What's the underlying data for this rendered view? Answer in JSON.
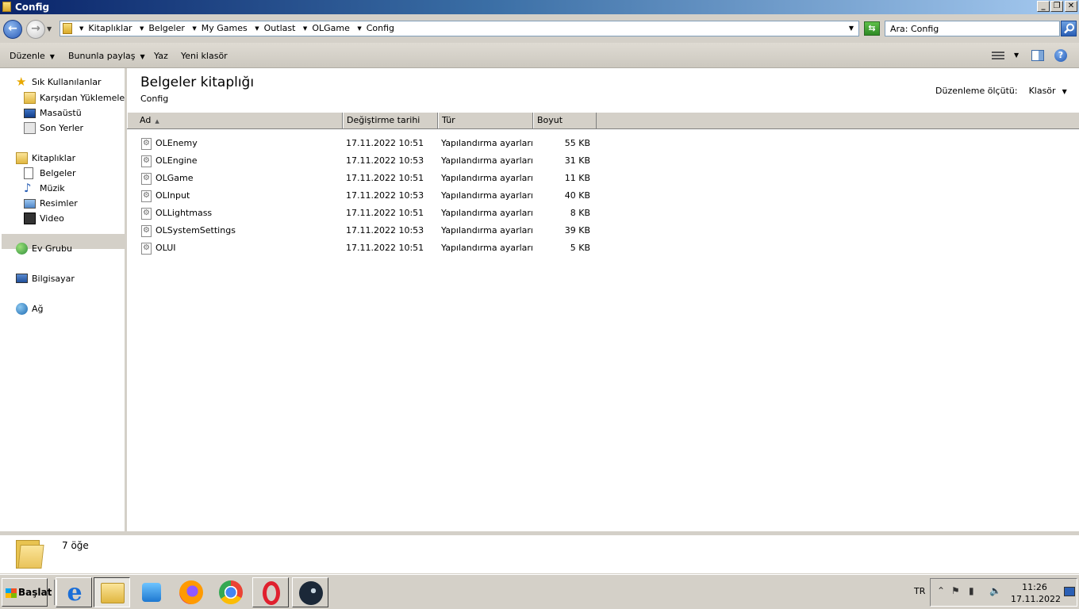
{
  "window": {
    "title": "Config",
    "controls": [
      "_",
      "❐",
      "✕"
    ]
  },
  "address": {
    "crumbs": [
      "Kitaplıklar",
      "Belgeler",
      "My Games",
      "Outlast",
      "OLGame",
      "Config"
    ]
  },
  "search": {
    "value": "Ara: Config"
  },
  "toolbar": {
    "organize": "Düzenle",
    "share": "Bununla paylaş",
    "burn": "Yaz",
    "new_folder": "Yeni klasör"
  },
  "nav": {
    "favorites": "Sık Kullanılanlar",
    "downloads": "Karşıdan Yüklemeler",
    "desktop": "Masaüstü",
    "recent": "Son Yerler",
    "libraries": "Kitaplıklar",
    "documents": "Belgeler",
    "music": "Müzik",
    "pictures": "Resimler",
    "video": "Video",
    "homegroup": "Ev Grubu",
    "computer": "Bilgisayar",
    "network": "Ağ"
  },
  "library": {
    "title": "Belgeler kitaplığı",
    "subtitle": "Config",
    "arrange_label": "Düzenleme ölçütü:",
    "arrange_value": "Klasör"
  },
  "columns": {
    "name": "Ad",
    "date": "Değiştirme tarihi",
    "type": "Tür",
    "size": "Boyut"
  },
  "files": [
    {
      "name": "OLEnemy",
      "date": "17.11.2022 10:51",
      "type": "Yapılandırma ayarları",
      "size": "55 KB"
    },
    {
      "name": "OLEngine",
      "date": "17.11.2022 10:53",
      "type": "Yapılandırma ayarları",
      "size": "31 KB"
    },
    {
      "name": "OLGame",
      "date": "17.11.2022 10:51",
      "type": "Yapılandırma ayarları",
      "size": "11 KB"
    },
    {
      "name": "OLInput",
      "date": "17.11.2022 10:53",
      "type": "Yapılandırma ayarları",
      "size": "40 KB"
    },
    {
      "name": "OLLightmass",
      "date": "17.11.2022 10:51",
      "type": "Yapılandırma ayarları",
      "size": "8 KB"
    },
    {
      "name": "OLSystemSettings",
      "date": "17.11.2022 10:53",
      "type": "Yapılandırma ayarları",
      "size": "39 KB"
    },
    {
      "name": "OLUI",
      "date": "17.11.2022 10:51",
      "type": "Yapılandırma ayarları",
      "size": "5 KB"
    }
  ],
  "details": {
    "count": "7 öğe"
  },
  "taskbar": {
    "start": "Başlat",
    "apps": [
      "internet-explorer-icon",
      "explorer-icon",
      "media-player-icon",
      "firefox-icon",
      "chrome-icon",
      "opera-icon",
      "steam-icon"
    ],
    "lang": "TR",
    "time": "11:26",
    "date": "17.11.2022"
  },
  "colors": {
    "titlebar_start": "#0a246a",
    "titlebar_end": "#a6caf0",
    "chrome": "#d4d0c8"
  }
}
